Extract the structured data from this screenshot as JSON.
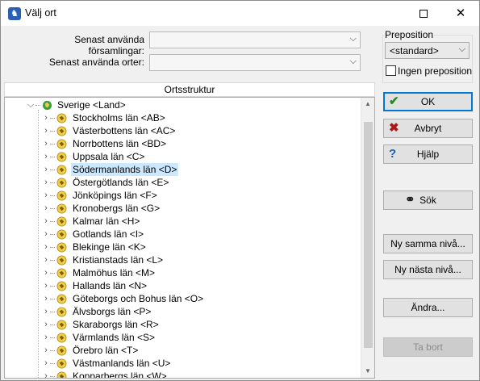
{
  "window": {
    "title": "Välj ort"
  },
  "form": {
    "recent_parishes_label": "Senast använda församlingar:",
    "recent_places_label": "Senast använda orter:",
    "recent_parishes_value": "",
    "recent_places_value": ""
  },
  "preposition": {
    "group_label": "Preposition",
    "selected": "<standard>",
    "no_preposition_label": "Ingen preposition",
    "no_preposition_checked": false
  },
  "tree": {
    "header": "Ortsstruktur",
    "root": "Sverige <Land>",
    "selected_index": 4,
    "items": [
      "Stockholms län <AB>",
      "Västerbottens län <AC>",
      "Norrbottens län <BD>",
      "Uppsala län <C>",
      "Södermanlands län <D>",
      "Östergötlands län <E>",
      "Jönköpings län <F>",
      "Kronobergs län <G>",
      "Kalmar län <H>",
      "Gotlands län <I>",
      "Blekinge län <K>",
      "Kristianstads län <L>",
      "Malmöhus län <M>",
      "Hallands län <N>",
      "Göteborgs och Bohus län <O>",
      "Älvsborgs län <P>",
      "Skaraborgs län <R>",
      "Värmlands län <S>",
      "Örebro län <T>",
      "Västmanlands län <U>",
      "Kopparbergs län <W>"
    ]
  },
  "buttons": {
    "ok": "OK",
    "cancel": "Avbryt",
    "help": "Hjälp",
    "search": "Sök",
    "new_same_level": "Ny samma nivå...",
    "new_next_level": "Ny nästa nivå...",
    "edit": "Ändra...",
    "remove": "Ta bort"
  },
  "colors": {
    "selection": "#cce8ff",
    "ok_check": "#2a8a2a",
    "cancel_x": "#b01818",
    "help_q": "#1e5bb8",
    "default_button_border": "#0078d7"
  }
}
